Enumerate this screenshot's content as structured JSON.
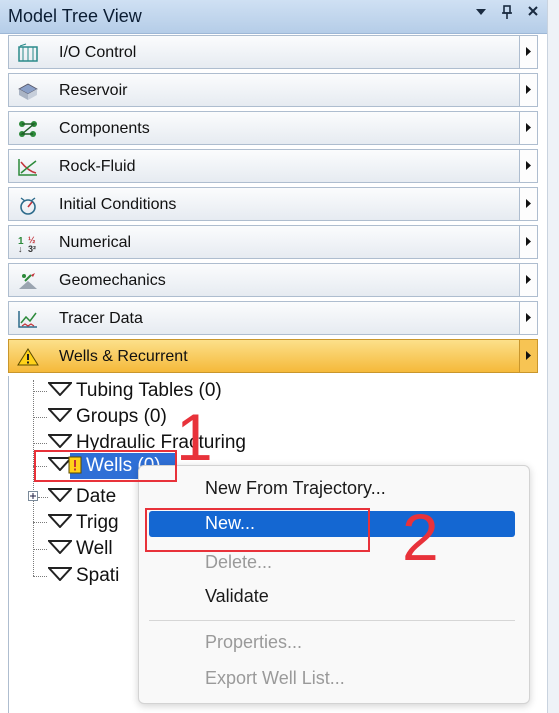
{
  "panel": {
    "title": "Model Tree View",
    "buttons": [
      "dropdown",
      "pin",
      "close"
    ]
  },
  "sections": [
    {
      "label": "I/O Control",
      "icon": "io-control-icon"
    },
    {
      "label": "Reservoir",
      "icon": "reservoir-icon"
    },
    {
      "label": "Components",
      "icon": "components-icon"
    },
    {
      "label": "Rock-Fluid",
      "icon": "rock-fluid-icon"
    },
    {
      "label": "Initial Conditions",
      "icon": "initial-conditions-icon"
    },
    {
      "label": "Numerical",
      "icon": "numerical-icon"
    },
    {
      "label": "Geomechanics",
      "icon": "geomechanics-icon"
    },
    {
      "label": "Tracer Data",
      "icon": "tracer-data-icon"
    },
    {
      "label": "Wells & Recurrent",
      "icon": "warning-icon",
      "active": true
    }
  ],
  "tree": {
    "items": [
      {
        "label": "Tubing Tables (0)"
      },
      {
        "label": "Groups (0)"
      },
      {
        "label": "Hydraulic Fracturing"
      },
      {
        "label": "Wells (0)",
        "selected": true,
        "warning": true
      },
      {
        "label": "Date"
      },
      {
        "label": "Trigg"
      },
      {
        "label": "Well"
      },
      {
        "label": "Spati"
      }
    ]
  },
  "context_menu": {
    "items": [
      {
        "label": "New From Trajectory...",
        "enabled": true
      },
      {
        "label": "New...",
        "enabled": true,
        "highlighted": true
      },
      {
        "label": "Delete...",
        "enabled": false
      },
      {
        "label": "Validate",
        "enabled": true
      },
      {
        "label": "Properties...",
        "enabled": false
      },
      {
        "label": "Export Well List...",
        "enabled": false
      }
    ]
  },
  "annotations": {
    "step1": "1",
    "step2": "2",
    "color": "#e8323a"
  },
  "colors": {
    "active_section": "#f5b93a",
    "selection": "#2f6fd6",
    "menu_highlight": "#1467d2"
  }
}
